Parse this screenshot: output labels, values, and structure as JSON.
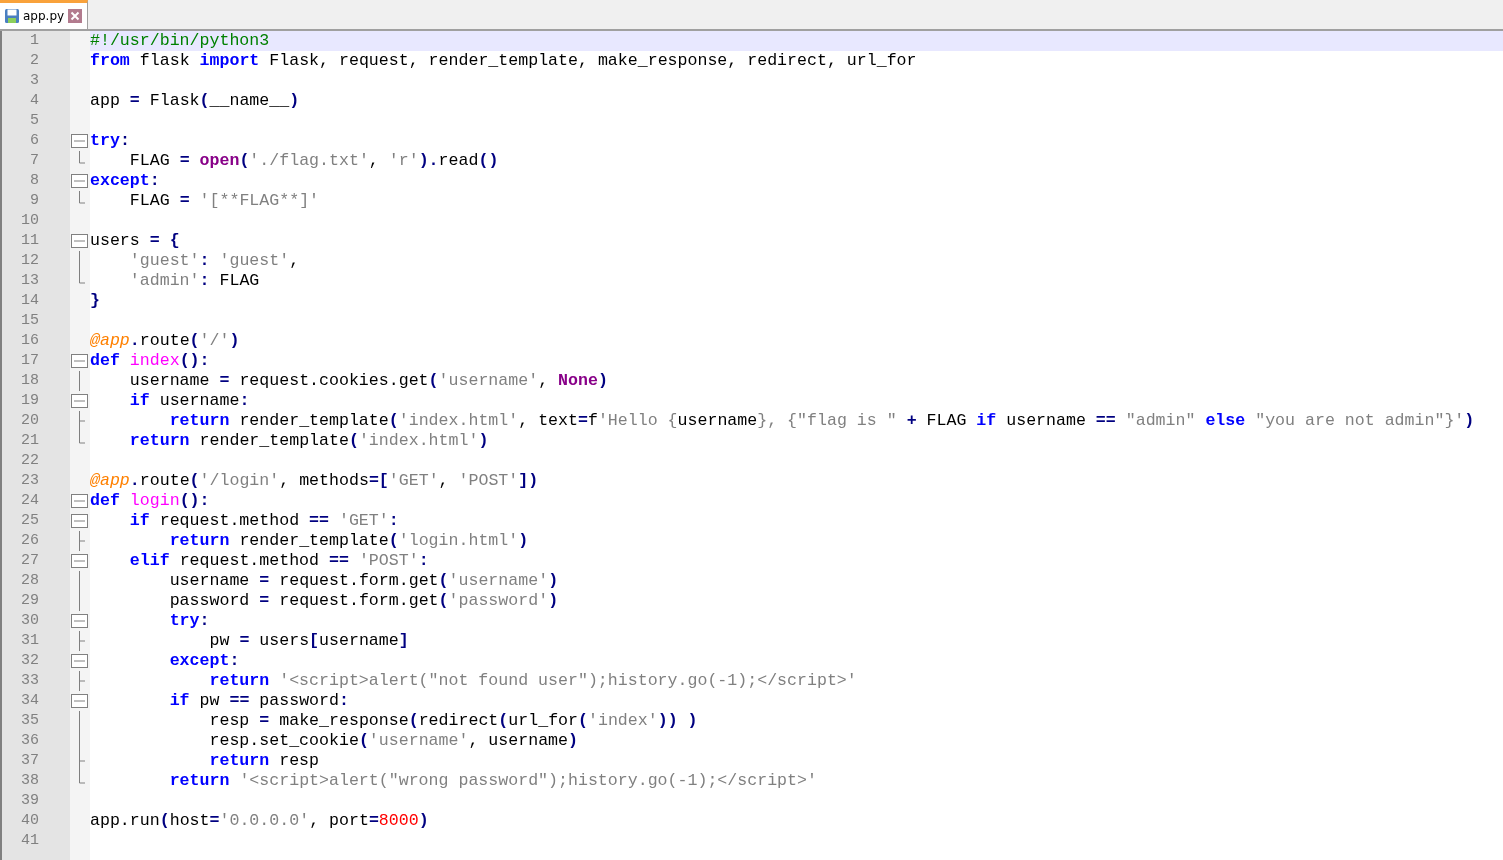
{
  "tabs": [
    {
      "label": "app.py",
      "selected": true
    }
  ],
  "lines": [
    {
      "number": "1",
      "current": true,
      "tokens": [
        {
          "kind": "comment",
          "text": "#!/usr/bin/python3"
        }
      ]
    },
    {
      "number": "2",
      "current": false,
      "tokens": [
        {
          "kind": "kw",
          "text": "from"
        },
        {
          "kind": "plain",
          "text": " flask "
        },
        {
          "kind": "kw",
          "text": "import"
        },
        {
          "kind": "plain",
          "text": " Flask, request, render_template, make_response, redirect, url_for"
        }
      ]
    },
    {
      "number": "3",
      "current": false
    },
    {
      "number": "4",
      "current": false,
      "tokens": [
        {
          "kind": "plain",
          "text": "app "
        },
        {
          "kind": "op",
          "text": "="
        },
        {
          "kind": "plain",
          "text": " Flask"
        },
        {
          "kind": "op",
          "text": "("
        },
        {
          "kind": "plain",
          "text": "__name__"
        },
        {
          "kind": "op",
          "text": ")"
        }
      ]
    },
    {
      "number": "5",
      "current": false
    },
    {
      "number": "6",
      "current": false,
      "fold": {
        "kind": "open"
      },
      "tokens": [
        {
          "kind": "kw",
          "text": "try"
        },
        {
          "kind": "op",
          "text": ":"
        }
      ]
    },
    {
      "number": "7",
      "current": false,
      "fold": {
        "kind": "end"
      },
      "tokens": [
        {
          "kind": "plain",
          "text": "    FLAG "
        },
        {
          "kind": "op",
          "text": "="
        },
        {
          "kind": "builtin",
          "text": " open"
        },
        {
          "kind": "op",
          "text": "("
        },
        {
          "kind": "str",
          "text": "'./flag.txt'"
        },
        {
          "kind": "plain",
          "text": ", "
        },
        {
          "kind": "str",
          "text": "'r'"
        },
        {
          "kind": "op",
          "text": ")."
        },
        {
          "kind": "plain",
          "text": "read"
        },
        {
          "kind": "op",
          "text": "()"
        }
      ]
    },
    {
      "number": "8",
      "current": false,
      "fold": {
        "kind": "open"
      },
      "tokens": [
        {
          "kind": "kw",
          "text": "except"
        },
        {
          "kind": "op",
          "text": ":"
        }
      ]
    },
    {
      "number": "9",
      "current": false,
      "fold": {
        "kind": "end"
      },
      "tokens": [
        {
          "kind": "plain",
          "text": "    FLAG "
        },
        {
          "kind": "op",
          "text": "="
        },
        {
          "kind": "str",
          "text": " '[**FLAG**]'"
        }
      ]
    },
    {
      "number": "10",
      "current": false
    },
    {
      "number": "11",
      "current": false,
      "fold": {
        "kind": "open"
      },
      "tokens": [
        {
          "kind": "plain",
          "text": "users "
        },
        {
          "kind": "op",
          "text": "= {"
        }
      ]
    },
    {
      "number": "12",
      "current": false,
      "fold": {
        "kind": "line"
      },
      "tokens": [
        {
          "kind": "str",
          "text": "    'guest'"
        },
        {
          "kind": "op",
          "text": ":"
        },
        {
          "kind": "str",
          "text": " 'guest'"
        },
        {
          "kind": "plain",
          "text": ","
        }
      ]
    },
    {
      "number": "13",
      "current": false,
      "fold": {
        "kind": "end"
      },
      "tokens": [
        {
          "kind": "str",
          "text": "    'admin'"
        },
        {
          "kind": "op",
          "text": ":"
        },
        {
          "kind": "plain",
          "text": " FLAG"
        }
      ]
    },
    {
      "number": "14",
      "current": false,
      "tokens": [
        {
          "kind": "op",
          "text": "}"
        }
      ]
    },
    {
      "number": "15",
      "current": false
    },
    {
      "number": "16",
      "current": false,
      "tokens": [
        {
          "kind": "deco",
          "text": "@app"
        },
        {
          "kind": "op",
          "text": "."
        },
        {
          "kind": "plain",
          "text": "route"
        },
        {
          "kind": "op",
          "text": "("
        },
        {
          "kind": "str",
          "text": "'/'"
        },
        {
          "kind": "op",
          "text": ")"
        }
      ]
    },
    {
      "number": "17",
      "current": false,
      "fold": {
        "kind": "open"
      },
      "tokens": [
        {
          "kind": "kw",
          "text": "def"
        },
        {
          "kind": "func",
          "text": " index"
        },
        {
          "kind": "op",
          "text": "():"
        }
      ]
    },
    {
      "number": "18",
      "current": false,
      "fold": {
        "kind": "line"
      },
      "tokens": [
        {
          "kind": "plain",
          "text": "    username "
        },
        {
          "kind": "op",
          "text": "="
        },
        {
          "kind": "plain",
          "text": " request.cookies.get"
        },
        {
          "kind": "op",
          "text": "("
        },
        {
          "kind": "str",
          "text": "'username'"
        },
        {
          "kind": "plain",
          "text": ", "
        },
        {
          "kind": "builtin",
          "text": "None"
        },
        {
          "kind": "op",
          "text": ")"
        }
      ]
    },
    {
      "number": "19",
      "current": false,
      "fold": {
        "kind": "open"
      },
      "tokens": [
        {
          "kind": "kw",
          "text": "    if"
        },
        {
          "kind": "plain",
          "text": " username"
        },
        {
          "kind": "op",
          "text": ":"
        }
      ]
    },
    {
      "number": "20",
      "current": false,
      "fold": {
        "kind": "mid"
      },
      "tokens": [
        {
          "kind": "kw",
          "text": "        return"
        },
        {
          "kind": "plain",
          "text": " render_template"
        },
        {
          "kind": "op",
          "text": "("
        },
        {
          "kind": "str",
          "text": "'index.html'"
        },
        {
          "kind": "plain",
          "text": ", text"
        },
        {
          "kind": "op",
          "text": "="
        },
        {
          "kind": "plain",
          "text": "f"
        },
        {
          "kind": "str",
          "text": "'Hello {"
        },
        {
          "kind": "plain",
          "text": "username"
        },
        {
          "kind": "str",
          "text": "}, {\"flag is \""
        },
        {
          "kind": "op",
          "text": " +"
        },
        {
          "kind": "plain",
          "text": " FLAG "
        },
        {
          "kind": "kw",
          "text": "if"
        },
        {
          "kind": "plain",
          "text": " username "
        },
        {
          "kind": "op",
          "text": "=="
        },
        {
          "kind": "str",
          "text": " \"admin\""
        },
        {
          "kind": "kw",
          "text": " else"
        },
        {
          "kind": "str",
          "text": " \"you are not admin\"}'"
        },
        {
          "kind": "op",
          "text": ")"
        }
      ]
    },
    {
      "number": "21",
      "current": false,
      "fold": {
        "kind": "end"
      },
      "tokens": [
        {
          "kind": "kw",
          "text": "    return"
        },
        {
          "kind": "plain",
          "text": " render_template"
        },
        {
          "kind": "op",
          "text": "("
        },
        {
          "kind": "str",
          "text": "'index.html'"
        },
        {
          "kind": "op",
          "text": ")"
        }
      ]
    },
    {
      "number": "22",
      "current": false
    },
    {
      "number": "23",
      "current": false,
      "tokens": [
        {
          "kind": "deco",
          "text": "@app"
        },
        {
          "kind": "op",
          "text": "."
        },
        {
          "kind": "plain",
          "text": "route"
        },
        {
          "kind": "op",
          "text": "("
        },
        {
          "kind": "str",
          "text": "'/login'"
        },
        {
          "kind": "plain",
          "text": ", methods"
        },
        {
          "kind": "op",
          "text": "=["
        },
        {
          "kind": "str",
          "text": "'GET'"
        },
        {
          "kind": "plain",
          "text": ", "
        },
        {
          "kind": "str",
          "text": "'POST'"
        },
        {
          "kind": "op",
          "text": "])"
        }
      ]
    },
    {
      "number": "24",
      "current": false,
      "fold": {
        "kind": "open"
      },
      "tokens": [
        {
          "kind": "kw",
          "text": "def"
        },
        {
          "kind": "func",
          "text": " login"
        },
        {
          "kind": "op",
          "text": "():"
        }
      ]
    },
    {
      "number": "25",
      "current": false,
      "fold": {
        "kind": "open"
      },
      "tokens": [
        {
          "kind": "kw",
          "text": "    if"
        },
        {
          "kind": "plain",
          "text": " request.method "
        },
        {
          "kind": "op",
          "text": "=="
        },
        {
          "kind": "str",
          "text": " 'GET'"
        },
        {
          "kind": "op",
          "text": ":"
        }
      ]
    },
    {
      "number": "26",
      "current": false,
      "fold": {
        "kind": "mid"
      },
      "tokens": [
        {
          "kind": "kw",
          "text": "        return"
        },
        {
          "kind": "plain",
          "text": " render_template"
        },
        {
          "kind": "op",
          "text": "("
        },
        {
          "kind": "str",
          "text": "'login.html'"
        },
        {
          "kind": "op",
          "text": ")"
        }
      ]
    },
    {
      "number": "27",
      "current": false,
      "fold": {
        "kind": "open"
      },
      "tokens": [
        {
          "kind": "kw",
          "text": "    elif"
        },
        {
          "kind": "plain",
          "text": " request.method "
        },
        {
          "kind": "op",
          "text": "=="
        },
        {
          "kind": "str",
          "text": " 'POST'"
        },
        {
          "kind": "op",
          "text": ":"
        }
      ]
    },
    {
      "number": "28",
      "current": false,
      "fold": {
        "kind": "line"
      },
      "tokens": [
        {
          "kind": "plain",
          "text": "        username "
        },
        {
          "kind": "op",
          "text": "="
        },
        {
          "kind": "plain",
          "text": " request.form.get"
        },
        {
          "kind": "op",
          "text": "("
        },
        {
          "kind": "str",
          "text": "'username'"
        },
        {
          "kind": "op",
          "text": ")"
        }
      ]
    },
    {
      "number": "29",
      "current": false,
      "fold": {
        "kind": "line"
      },
      "tokens": [
        {
          "kind": "plain",
          "text": "        password "
        },
        {
          "kind": "op",
          "text": "="
        },
        {
          "kind": "plain",
          "text": " request.form.get"
        },
        {
          "kind": "op",
          "text": "("
        },
        {
          "kind": "str",
          "text": "'password'"
        },
        {
          "kind": "op",
          "text": ")"
        }
      ]
    },
    {
      "number": "30",
      "current": false,
      "fold": {
        "kind": "open"
      },
      "tokens": [
        {
          "kind": "kw",
          "text": "        try"
        },
        {
          "kind": "op",
          "text": ":"
        }
      ]
    },
    {
      "number": "31",
      "current": false,
      "fold": {
        "kind": "mid"
      },
      "tokens": [
        {
          "kind": "plain",
          "text": "            pw "
        },
        {
          "kind": "op",
          "text": "="
        },
        {
          "kind": "plain",
          "text": " users"
        },
        {
          "kind": "op",
          "text": "["
        },
        {
          "kind": "plain",
          "text": "username"
        },
        {
          "kind": "op",
          "text": "]"
        }
      ]
    },
    {
      "number": "32",
      "current": false,
      "fold": {
        "kind": "open"
      },
      "tokens": [
        {
          "kind": "kw",
          "text": "        except"
        },
        {
          "kind": "op",
          "text": ":"
        }
      ]
    },
    {
      "number": "33",
      "current": false,
      "fold": {
        "kind": "mid"
      },
      "tokens": [
        {
          "kind": "kw",
          "text": "            return"
        },
        {
          "kind": "str",
          "text": " '<script>alert(\"not found user\");history.go(-1);</script>'"
        }
      ]
    },
    {
      "number": "34",
      "current": false,
      "fold": {
        "kind": "open"
      },
      "tokens": [
        {
          "kind": "kw",
          "text": "        if"
        },
        {
          "kind": "plain",
          "text": " pw "
        },
        {
          "kind": "op",
          "text": "=="
        },
        {
          "kind": "plain",
          "text": " password"
        },
        {
          "kind": "op",
          "text": ":"
        }
      ]
    },
    {
      "number": "35",
      "current": false,
      "fold": {
        "kind": "line"
      },
      "tokens": [
        {
          "kind": "plain",
          "text": "            resp "
        },
        {
          "kind": "op",
          "text": "="
        },
        {
          "kind": "plain",
          "text": " make_response"
        },
        {
          "kind": "op",
          "text": "("
        },
        {
          "kind": "plain",
          "text": "redirect"
        },
        {
          "kind": "op",
          "text": "("
        },
        {
          "kind": "plain",
          "text": "url_for"
        },
        {
          "kind": "op",
          "text": "("
        },
        {
          "kind": "str",
          "text": "'index'"
        },
        {
          "kind": "op",
          "text": ")) )"
        }
      ]
    },
    {
      "number": "36",
      "current": false,
      "fold": {
        "kind": "line"
      },
      "tokens": [
        {
          "kind": "plain",
          "text": "            resp.set_cookie"
        },
        {
          "kind": "op",
          "text": "("
        },
        {
          "kind": "str",
          "text": "'username'"
        },
        {
          "kind": "plain",
          "text": ", username"
        },
        {
          "kind": "op",
          "text": ")"
        }
      ]
    },
    {
      "number": "37",
      "current": false,
      "fold": {
        "kind": "mid"
      },
      "tokens": [
        {
          "kind": "kw",
          "text": "            return"
        },
        {
          "kind": "plain",
          "text": " resp"
        }
      ]
    },
    {
      "number": "38",
      "current": false,
      "fold": {
        "kind": "end"
      },
      "tokens": [
        {
          "kind": "kw",
          "text": "        return"
        },
        {
          "kind": "str",
          "text": " '<script>alert(\"wrong password\");history.go(-1);</script>'"
        }
      ]
    },
    {
      "number": "39",
      "current": false
    },
    {
      "number": "40",
      "current": false,
      "tokens": [
        {
          "kind": "plain",
          "text": "app.run"
        },
        {
          "kind": "op",
          "text": "("
        },
        {
          "kind": "plain",
          "text": "host"
        },
        {
          "kind": "op",
          "text": "="
        },
        {
          "kind": "str",
          "text": "'0.0.0.0'"
        },
        {
          "kind": "plain",
          "text": ", port"
        },
        {
          "kind": "op",
          "text": "="
        },
        {
          "kind": "num",
          "text": "8000"
        },
        {
          "kind": "op",
          "text": ")"
        }
      ]
    },
    {
      "number": "41",
      "current": false
    }
  ]
}
